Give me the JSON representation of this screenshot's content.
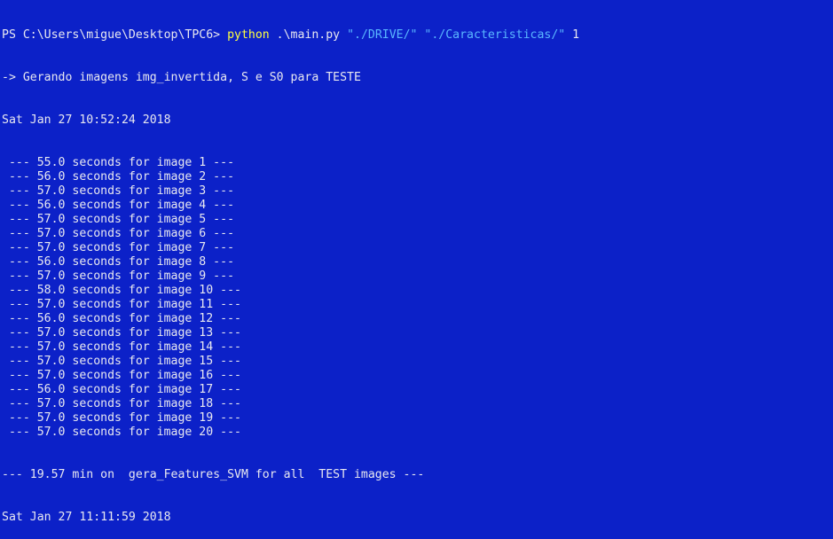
{
  "colors": {
    "background": "#0c21c8",
    "text": "#e8e8f0",
    "command": "#ffff40",
    "string_arg": "#5ab7ff"
  },
  "command_line": {
    "prompt": "PS C:\\Users\\migue\\Desktop\\TPC6> ",
    "command": "python",
    "script": " .\\main.py ",
    "arg1": "\"./DRIVE/\"",
    "sep": " ",
    "arg2": "\"./Caracteristicas/\"",
    "arg3": " 1"
  },
  "output": {
    "header": "-> Gerando imagens img_invertida, S e S0 para TESTE",
    "start_time": "Sat Jan 27 10:52:24 2018",
    "lines": [
      " --- 55.0 seconds for image 1 ---",
      " --- 56.0 seconds for image 2 ---",
      " --- 57.0 seconds for image 3 ---",
      " --- 56.0 seconds for image 4 ---",
      " --- 57.0 seconds for image 5 ---",
      " --- 57.0 seconds for image 6 ---",
      " --- 57.0 seconds for image 7 ---",
      " --- 56.0 seconds for image 8 ---",
      " --- 57.0 seconds for image 9 ---",
      " --- 58.0 seconds for image 10 ---",
      " --- 57.0 seconds for image 11 ---",
      " --- 56.0 seconds for image 12 ---",
      " --- 57.0 seconds for image 13 ---",
      " --- 57.0 seconds for image 14 ---",
      " --- 57.0 seconds for image 15 ---",
      " --- 57.0 seconds for image 16 ---",
      " --- 56.0 seconds for image 17 ---",
      " --- 57.0 seconds for image 18 ---",
      " --- 57.0 seconds for image 19 ---",
      " --- 57.0 seconds for image 20 ---"
    ],
    "summary": "--- 19.57 min on  gera_Features_SVM for all  TEST images ---",
    "end_time": "Sat Jan 27 11:11:59 2018"
  }
}
